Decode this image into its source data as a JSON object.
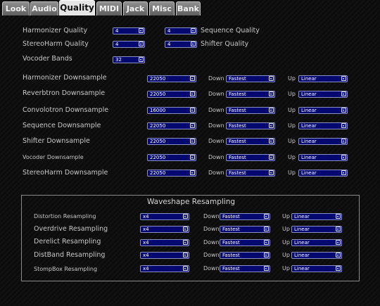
{
  "tabs": [
    "Look",
    "Audio",
    "Quality",
    "MIDI",
    "Jack",
    "Misc",
    "Bank"
  ],
  "quality": {
    "harmonizer_quality": {
      "label": "Harmonizer Quality",
      "value": "4"
    },
    "stereoharm_quality": {
      "label": "StereoHarm Quality",
      "value": "4"
    },
    "vocoder_bands": {
      "label": "Vocoder Bands",
      "value": "32"
    },
    "sequence_quality": {
      "label": "Sequence Quality",
      "value": "4"
    },
    "shifter_quality": {
      "label": "Shifter Quality",
      "value": "4"
    }
  },
  "downsample": {
    "down_label": "Down",
    "up_label": "Up",
    "rows": [
      {
        "label": "Harmonizer Downsample",
        "rate": "22050",
        "down": "Fastest",
        "up": "Linear"
      },
      {
        "label": "Reverbtron Downsample",
        "rate": "22050",
        "down": "Fastest",
        "up": "Linear"
      },
      {
        "label": "Convolotron Downsample",
        "rate": "16000",
        "down": "Fastest",
        "up": "Linear"
      },
      {
        "label": "Sequence Downsample",
        "rate": "22050",
        "down": "Fastest",
        "up": "Linear"
      },
      {
        "label": "Shifter Downsample",
        "rate": "22050",
        "down": "Fastest",
        "up": "Linear"
      },
      {
        "label": "Vocoder Downsample",
        "rate": "22050",
        "down": "Fastest",
        "up": "Linear"
      },
      {
        "label": "StereoHarm Downsample",
        "rate": "22050",
        "down": "Fastest",
        "up": "Linear"
      }
    ]
  },
  "waveshape": {
    "title": "Waveshape Resampling",
    "down_label": "Down",
    "up_label": "Up",
    "rows": [
      {
        "label": "Distortion Resampling",
        "factor": "x4",
        "down": "Fastest",
        "up": "Linear"
      },
      {
        "label": "Overdrive Resampling",
        "factor": "x4",
        "down": "Fastest",
        "up": "Linear"
      },
      {
        "label": "Derelict Resampling",
        "factor": "x4",
        "down": "Fastest",
        "up": "Linear"
      },
      {
        "label": "DistBand Resampling",
        "factor": "x4",
        "down": "Fastest",
        "up": "Linear"
      },
      {
        "label": "StompBox Resampling",
        "factor": "x4",
        "down": "Fastest",
        "up": "Linear"
      }
    ]
  }
}
